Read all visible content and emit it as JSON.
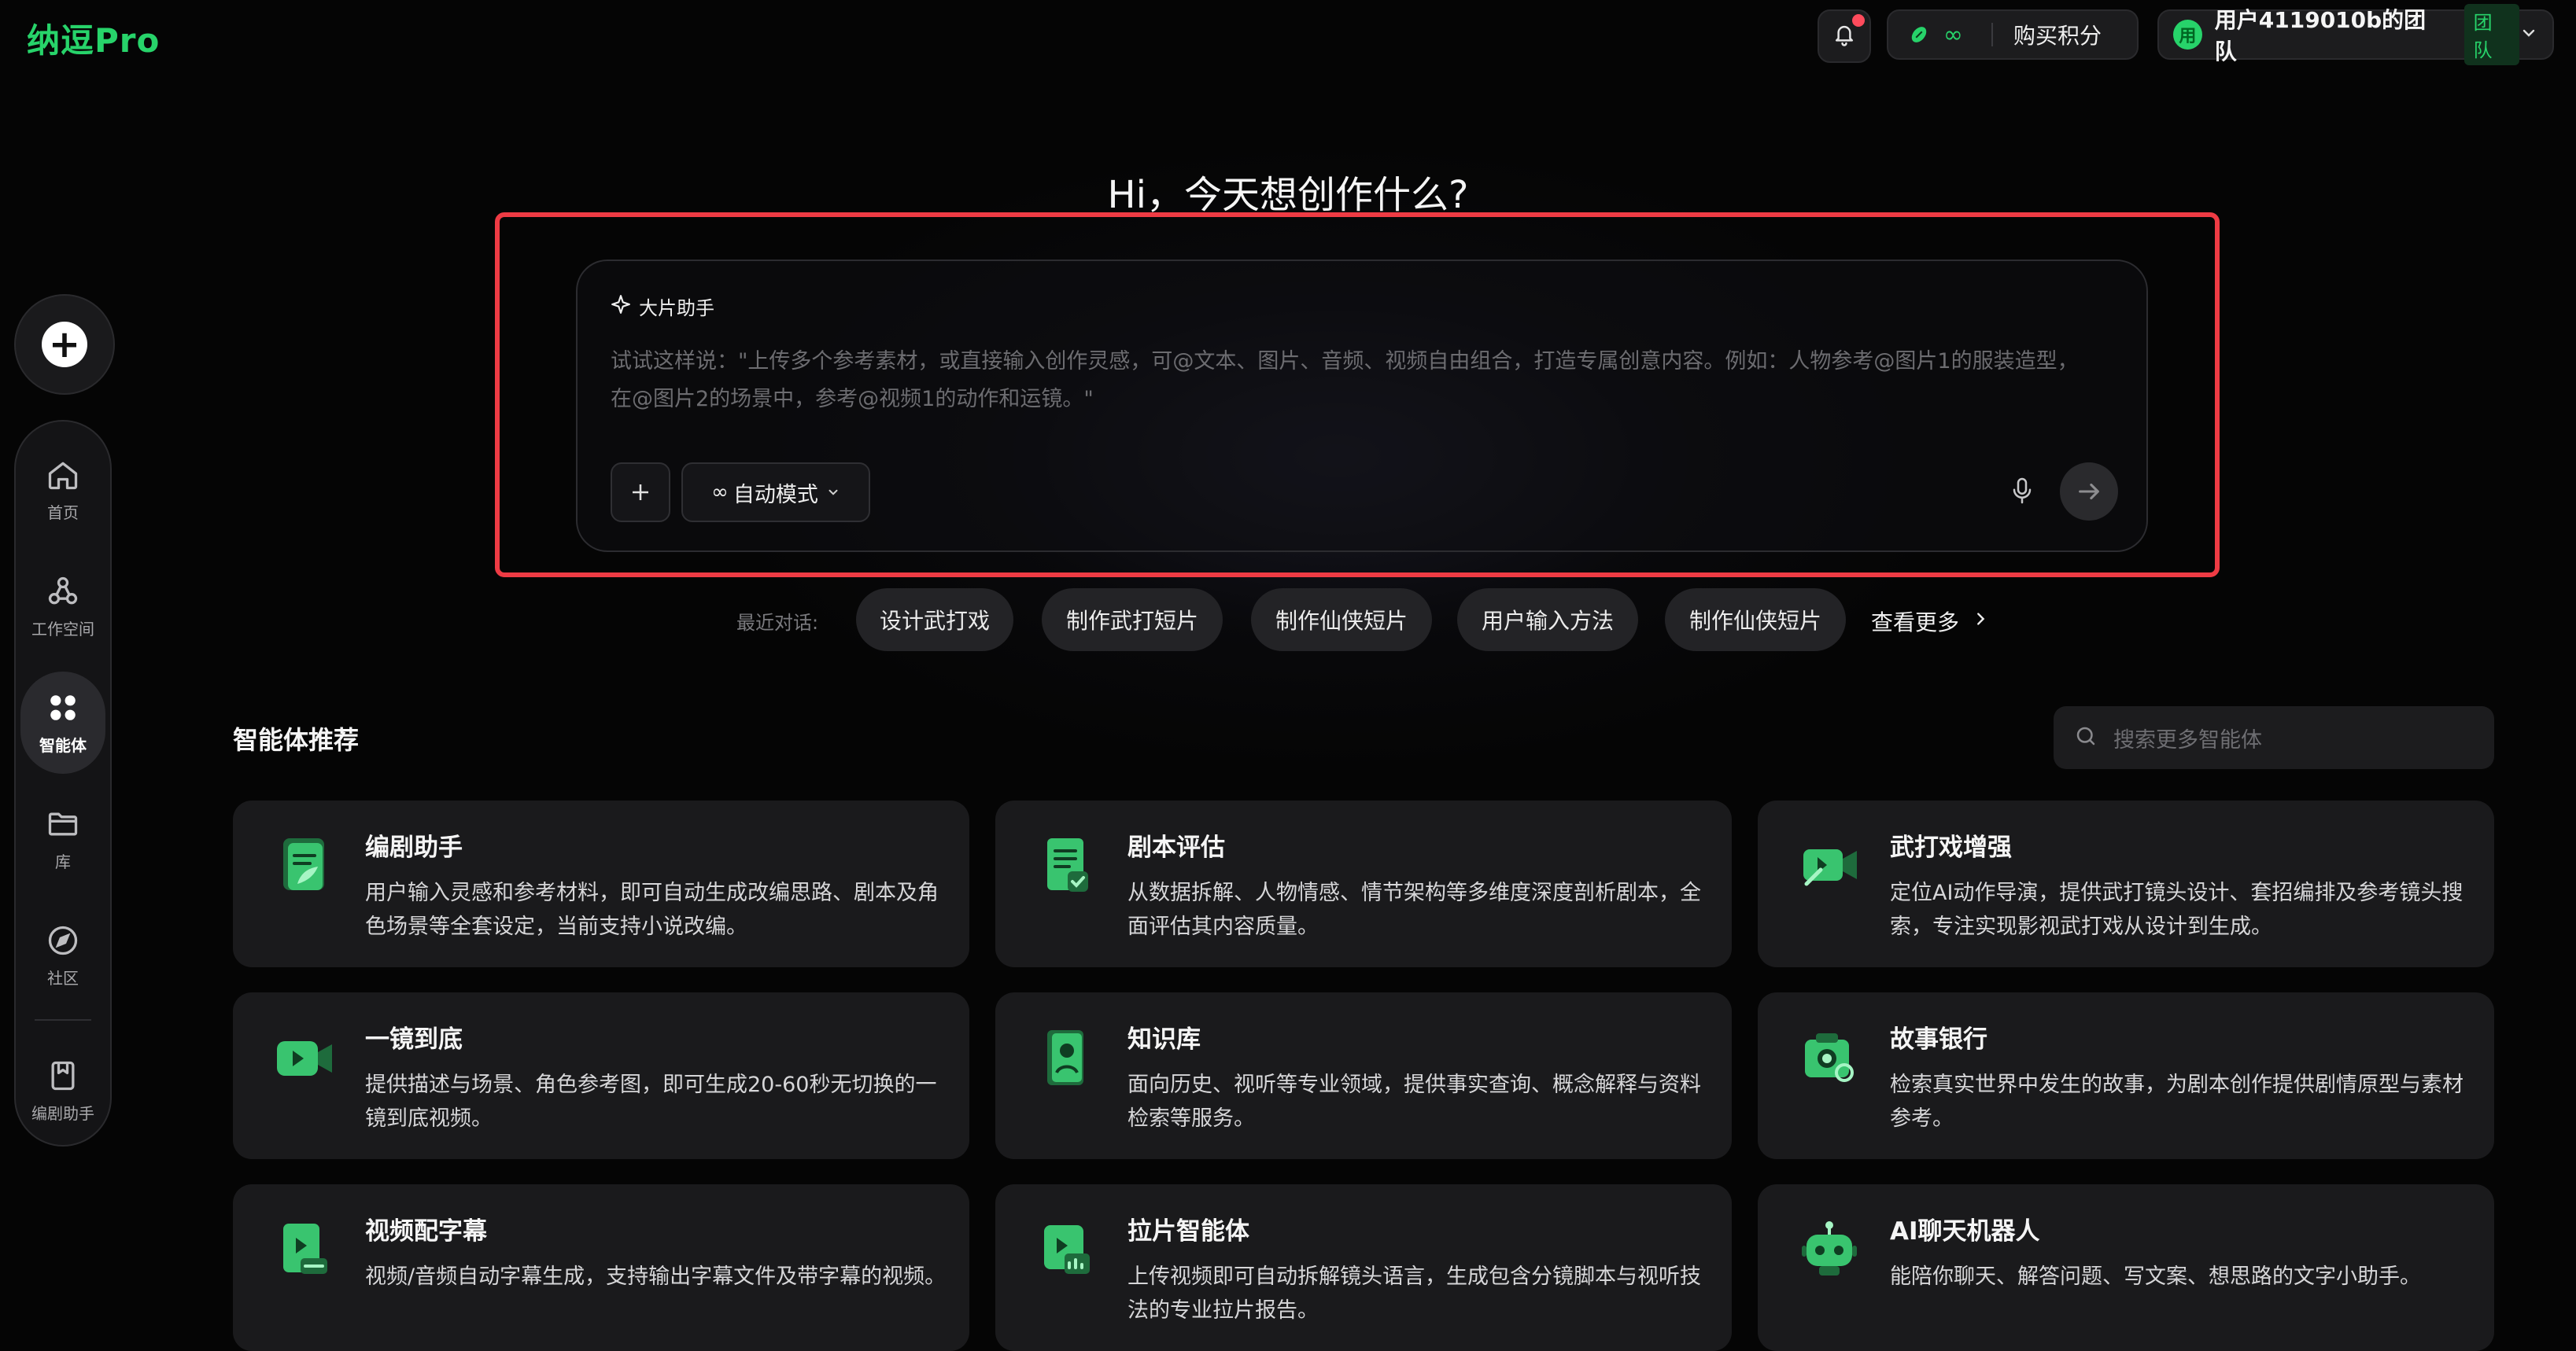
{
  "brand": {
    "logo": "纳逗Pro",
    "accent": "#27d36a"
  },
  "topbar": {
    "credits_value": "∞",
    "buy_label": "购买积分",
    "team_avatar": "用",
    "team_name": "用户4119010b的团队",
    "team_tag": "团队"
  },
  "sidebar": {
    "new_label": "+",
    "items": [
      {
        "label": "首页",
        "icon": "home-icon"
      },
      {
        "label": "工作空间",
        "icon": "workspace-icon"
      },
      {
        "label": "智能体",
        "icon": "agents-icon",
        "active": true
      },
      {
        "label": "库",
        "icon": "folder-icon"
      },
      {
        "label": "社区",
        "icon": "compass-icon"
      },
      {
        "label": "编剧助手",
        "icon": "bookmark-icon"
      }
    ]
  },
  "hero": {
    "title": "Hi，今天想创作什么?"
  },
  "composer": {
    "agent_label": "大片助手",
    "placeholder": "试试这样说：\"上传多个参考素材，或直接输入创作灵感，可@文本、图片、音频、视频自由组合，打造专属创意内容。例如：人物参考@图片1的服装造型，在@图片2的场景中，参考@视频1的动作和运镜。\"",
    "mode_label": "自动模式",
    "mode_icon": "∞"
  },
  "recent": {
    "label": "最近对话:",
    "chips": [
      "设计武打戏",
      "制作武打短片",
      "制作仙侠短片",
      "用户输入方法",
      "制作仙侠短片"
    ],
    "more": "查看更多"
  },
  "agents": {
    "section_title": "智能体推荐",
    "search_placeholder": "搜索更多智能体",
    "cards": [
      {
        "title": "编剧助手",
        "desc": "用户输入灵感和参考材料，即可自动生成改编思路、剧本及角色场景等全套设定，当前支持小说改编。",
        "icon": "script-assistant-icon"
      },
      {
        "title": "剧本评估",
        "desc": "从数据拆解、人物情感、情节架构等多维度深度剖析剧本，全面评估其内容质量。",
        "icon": "script-evaluation-icon"
      },
      {
        "title": "武打戏增强",
        "desc": "定位AI动作导演，提供武打镜头设计、套招编排及参考镜头搜索，专注实现影视武打戏从设计到生成。",
        "icon": "action-scene-icon"
      },
      {
        "title": "一镜到底",
        "desc": "提供描述与场景、角色参考图，即可生成20-60秒无切换的一镜到底视频。",
        "icon": "one-take-camera-icon"
      },
      {
        "title": "知识库",
        "desc": "面向历史、视听等专业领域，提供事实查询、概念解释与资料检索等服务。",
        "icon": "knowledge-base-icon"
      },
      {
        "title": "故事银行",
        "desc": "检索真实世界中发生的故事，为剧本创作提供剧情原型与素材参考。",
        "icon": "story-bank-icon"
      },
      {
        "title": "视频配字幕",
        "desc": "视频/音频自动字幕生成，支持输出字幕文件及带字幕的视频。",
        "icon": "subtitle-icon"
      },
      {
        "title": "拉片智能体",
        "desc": "上传视频即可自动拆解镜头语言，生成包含分镜脚本与视听技法的专业拉片报告。",
        "icon": "film-analysis-icon"
      },
      {
        "title": "AI聊天机器人",
        "desc": "能陪你聊天、解答问题、写文案、想思路的文字小助手。",
        "icon": "chat-robot-icon"
      }
    ]
  }
}
